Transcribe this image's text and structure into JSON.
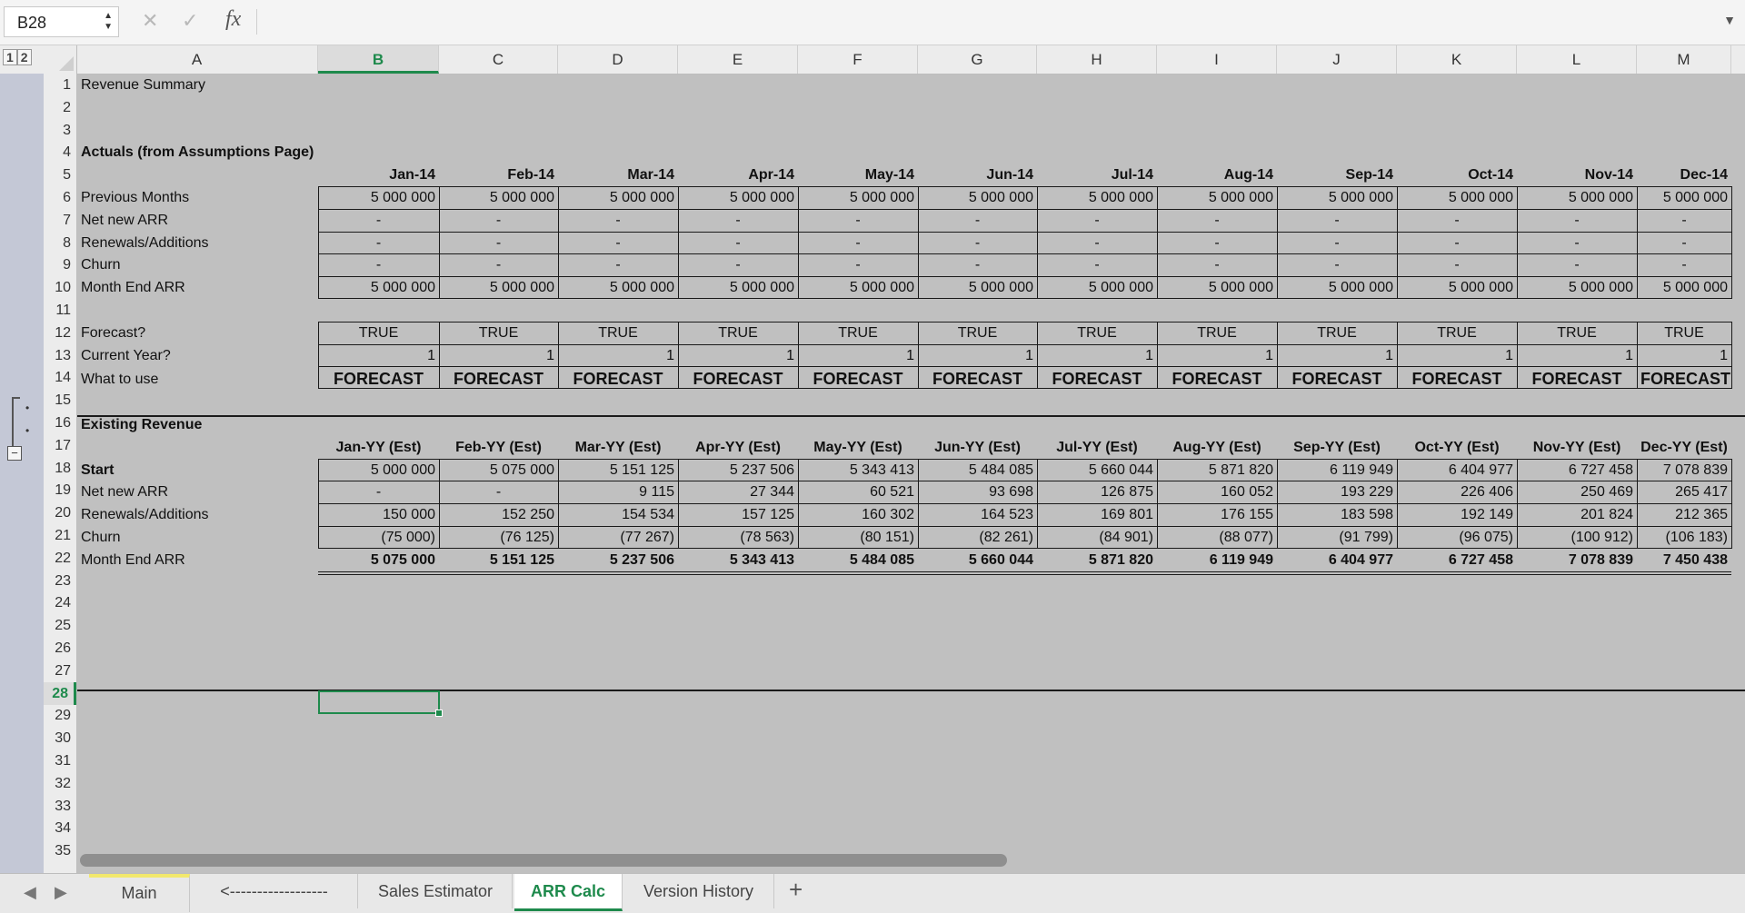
{
  "formula_bar": {
    "name_box": "B28",
    "cancel_icon": "close-icon",
    "enter_icon": "check-icon",
    "fx_label": "fx",
    "formula": ""
  },
  "outline_levels": [
    "1",
    "2"
  ],
  "columns": [
    "A",
    "B",
    "C",
    "D",
    "E",
    "F",
    "G",
    "H",
    "I",
    "J",
    "K",
    "L",
    "M"
  ],
  "selected_column": "B",
  "rows": [
    "1",
    "2",
    "3",
    "4",
    "5",
    "6",
    "7",
    "8",
    "9",
    "10",
    "11",
    "12",
    "13",
    "14",
    "15",
    "16",
    "17",
    "18",
    "19",
    "20",
    "21",
    "22",
    "23",
    "24",
    "25",
    "26",
    "27",
    "28",
    "29",
    "30",
    "31",
    "32",
    "33",
    "34",
    "35"
  ],
  "selected_row": "28",
  "sheet": {
    "title": "Revenue Summary",
    "actuals_header": "Actuals (from Assumptions Page)",
    "actual_months": [
      "Jan-14",
      "Feb-14",
      "Mar-14",
      "Apr-14",
      "May-14",
      "Jun-14",
      "Jul-14",
      "Aug-14",
      "Sep-14",
      "Oct-14",
      "Nov-14",
      "Dec-14"
    ],
    "actuals": [
      {
        "label": "Previous Months",
        "values": [
          "5 000 000",
          "5 000 000",
          "5 000 000",
          "5 000 000",
          "5 000 000",
          "5 000 000",
          "5 000 000",
          "5 000 000",
          "5 000 000",
          "5 000 000",
          "5 000 000",
          "5 000 000"
        ]
      },
      {
        "label": "Net new ARR",
        "values": [
          "-",
          "-",
          "-",
          "-",
          "-",
          "-",
          "-",
          "-",
          "-",
          "-",
          "-",
          "-"
        ]
      },
      {
        "label": "Renewals/Additions",
        "values": [
          "-",
          "-",
          "-",
          "-",
          "-",
          "-",
          "-",
          "-",
          "-",
          "-",
          "-",
          "-"
        ]
      },
      {
        "label": "Churn",
        "values": [
          "-",
          "-",
          "-",
          "-",
          "-",
          "-",
          "-",
          "-",
          "-",
          "-",
          "-",
          "-"
        ]
      },
      {
        "label": "Month End ARR",
        "values": [
          "5 000 000",
          "5 000 000",
          "5 000 000",
          "5 000 000",
          "5 000 000",
          "5 000 000",
          "5 000 000",
          "5 000 000",
          "5 000 000",
          "5 000 000",
          "5 000 000",
          "5 000 000"
        ]
      }
    ],
    "flags": [
      {
        "label": "Forecast?",
        "values": [
          "TRUE",
          "TRUE",
          "TRUE",
          "TRUE",
          "TRUE",
          "TRUE",
          "TRUE",
          "TRUE",
          "TRUE",
          "TRUE",
          "TRUE",
          "TRUE"
        ]
      },
      {
        "label": "Current Year?",
        "values": [
          "1",
          "1",
          "1",
          "1",
          "1",
          "1",
          "1",
          "1",
          "1",
          "1",
          "1",
          "1"
        ]
      },
      {
        "label": "What to use",
        "values": [
          "FORECAST",
          "FORECAST",
          "FORECAST",
          "FORECAST",
          "FORECAST",
          "FORECAST",
          "FORECAST",
          "FORECAST",
          "FORECAST",
          "FORECAST",
          "FORECAST",
          "FORECAST"
        ]
      }
    ],
    "existing_header": "Existing Revenue",
    "est_months": [
      "Jan-YY (Est)",
      "Feb-YY (Est)",
      "Mar-YY (Est)",
      "Apr-YY (Est)",
      "May-YY (Est)",
      "Jun-YY (Est)",
      "Jul-YY (Est)",
      "Aug-YY (Est)",
      "Sep-YY (Est)",
      "Oct-YY (Est)",
      "Nov-YY (Est)",
      "Dec-YY (Est)"
    ],
    "existing": [
      {
        "label": "Start",
        "values": [
          "5 000 000",
          "5 075 000",
          "5 151 125",
          "5 237 506",
          "5 343 413",
          "5 484 085",
          "5 660 044",
          "5 871 820",
          "6 119 949",
          "6 404 977",
          "6 727 458",
          "7 078 839"
        ]
      },
      {
        "label": "Net new ARR",
        "values": [
          "-",
          "-",
          "9 115",
          "27 344",
          "60 521",
          "93 698",
          "126 875",
          "160 052",
          "193 229",
          "226 406",
          "250 469",
          "265 417"
        ]
      },
      {
        "label": "Renewals/Additions",
        "values": [
          "150 000",
          "152 250",
          "154 534",
          "157 125",
          "160 302",
          "164 523",
          "169 801",
          "176 155",
          "183 598",
          "192 149",
          "201 824",
          "212 365"
        ]
      },
      {
        "label": "Churn",
        "values": [
          "(75 000)",
          "(76 125)",
          "(77 267)",
          "(78 563)",
          "(80 151)",
          "(82 261)",
          "(84 901)",
          "(88 077)",
          "(91 799)",
          "(96 075)",
          "(100 912)",
          "(106 183)"
        ]
      },
      {
        "label": "Month End ARR",
        "values": [
          "5 075 000",
          "5 151 125",
          "5 237 506",
          "5 343 413",
          "5 484 085",
          "5 660 044",
          "5 871 820",
          "6 119 949",
          "6 404 977",
          "6 727 458",
          "7 078 839",
          "7 450 438"
        ]
      }
    ]
  },
  "tabs": [
    {
      "label": "Main",
      "active": false
    },
    {
      "label": "<------------------",
      "active": false
    },
    {
      "label": "Sales Estimator",
      "active": false
    },
    {
      "label": "ARR Calc",
      "active": true
    },
    {
      "label": "Version History",
      "active": false
    }
  ],
  "add_tab_label": "+",
  "colors": {
    "accent": "#1e8a4c",
    "sheet_bg": "#c0c0c0",
    "outline_gutter": "#c4c8d6"
  }
}
